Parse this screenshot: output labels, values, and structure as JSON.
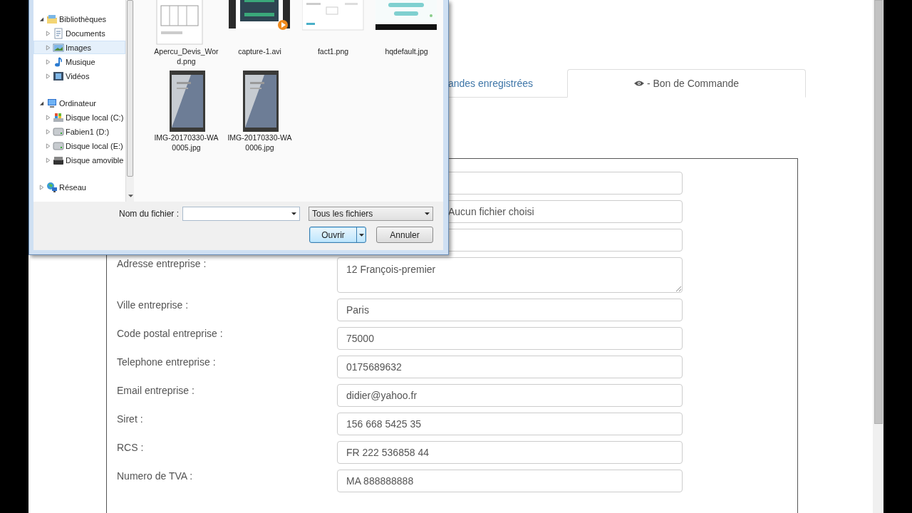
{
  "page": {
    "tabs": [
      {
        "label": "andes enregistrées",
        "selected": false,
        "kind": "plain"
      },
      {
        "label": "- Bon de Commande",
        "selected": true,
        "kind": "eye"
      }
    ],
    "form": [
      {
        "kind": "text"
      },
      {
        "kind": "file",
        "value": "Aucun fichier choisi"
      },
      {
        "kind": "text"
      },
      {
        "kind": "textarea",
        "label": "Adresse entreprise :",
        "value": "12 François-premier"
      },
      {
        "kind": "text",
        "label": "Ville entreprise :",
        "value": "Paris"
      },
      {
        "kind": "text",
        "label": "Code postal entreprise :",
        "value": "75000"
      },
      {
        "kind": "text",
        "label": "Telephone entreprise :",
        "value": "0175689632"
      },
      {
        "kind": "text",
        "label": "Email entreprise :",
        "value": "didier@yahoo.fr"
      },
      {
        "kind": "text",
        "label": "Siret :",
        "value": "156 668 5425 35"
      },
      {
        "kind": "text",
        "label": "RCS :",
        "value": "FR 222 536858 44"
      },
      {
        "kind": "text",
        "label": "Numero de TVA :",
        "value": "MA 888888888"
      }
    ]
  },
  "file_dialog": {
    "nav_tree": [
      {
        "label": "Bibliothèques",
        "kind": "library",
        "expanded": true,
        "selected": false,
        "children": [
          {
            "label": "Documents",
            "kind": "documents",
            "expanded": false,
            "selected": false
          },
          {
            "label": "Images",
            "kind": "pictures",
            "expanded": false,
            "selected": true
          },
          {
            "label": "Musique",
            "kind": "music",
            "expanded": false,
            "selected": false
          },
          {
            "label": "Vidéos",
            "kind": "videos",
            "expanded": false,
            "selected": false
          }
        ]
      },
      {
        "label": "Ordinateur",
        "kind": "computer",
        "expanded": true,
        "selected": false,
        "children": [
          {
            "label": "Disque local (C:)",
            "kind": "system-disk",
            "expanded": false,
            "selected": false
          },
          {
            "label": "Fabien1 (D:)",
            "kind": "disk",
            "expanded": false,
            "selected": false
          },
          {
            "label": "Disque local (E:)",
            "kind": "disk",
            "expanded": false,
            "selected": false
          },
          {
            "label": "Disque amovible",
            "kind": "removable",
            "expanded": false,
            "selected": false
          }
        ]
      },
      {
        "label": "Réseau",
        "kind": "network",
        "expanded": false,
        "selected": false
      }
    ],
    "files": [
      {
        "name": "Apercu_Devis_Word.png",
        "kind": "document"
      },
      {
        "name": "capture-1.avi",
        "kind": "video"
      },
      {
        "name": "fact1.png",
        "kind": "screenshot"
      },
      {
        "name": "hqdefault.jpg",
        "kind": "card"
      },
      {
        "name": "IMG-20170330-WA0005.jpg"
      },
      {
        "name": "IMG-20170330-WA0006.jpg"
      }
    ],
    "filename_label": "Nom du fichier :",
    "file_type": "Tous les fichiers",
    "buttons": [
      {
        "label": "Ouvrir",
        "kind": "default"
      },
      {
        "label": "Annuler",
        "kind": "normal"
      }
    ]
  }
}
